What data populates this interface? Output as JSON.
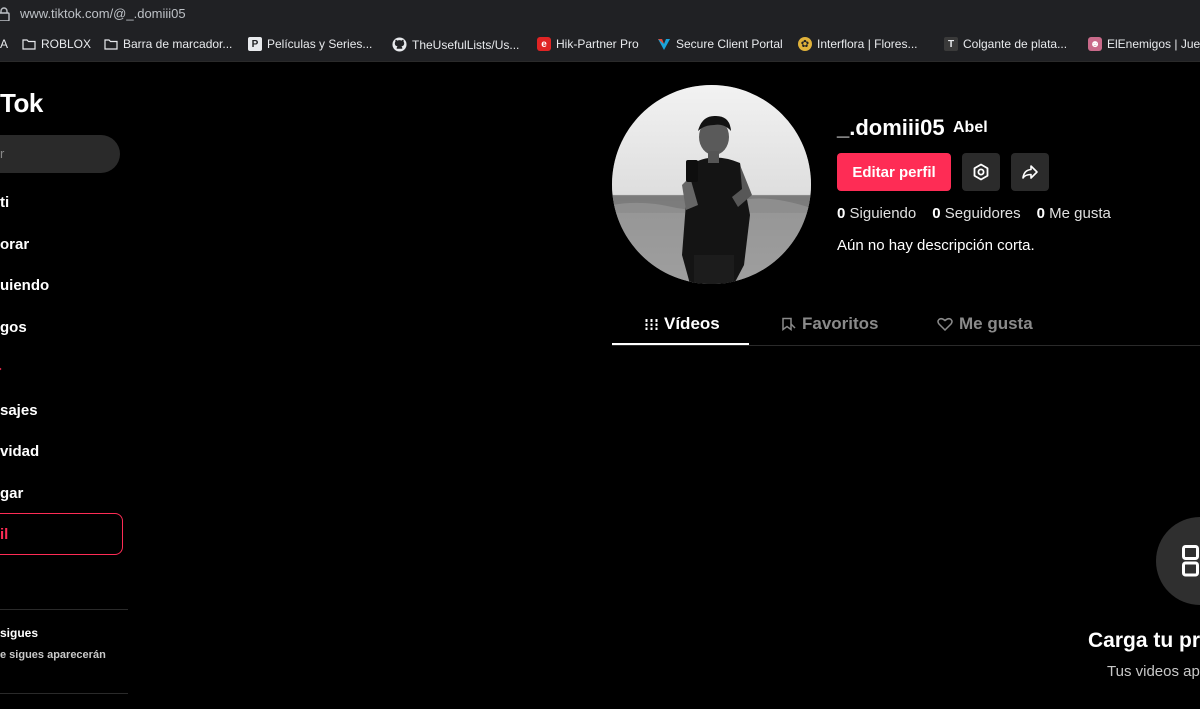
{
  "browser": {
    "url": "www.tiktok.com/@_.domiii05",
    "bookmarks": [
      {
        "label": "A"
      },
      {
        "label": "ROBLOX"
      },
      {
        "label": "Barra de marcador..."
      },
      {
        "label": "Películas y Series..."
      },
      {
        "label": "TheUsefulLists/Us..."
      },
      {
        "label": "Hik-Partner Pro"
      },
      {
        "label": "Secure Client Portal"
      },
      {
        "label": "Interflora | Flores..."
      },
      {
        "label": "Colgante de plata..."
      },
      {
        "label": "ElEnemigos | Jue"
      }
    ]
  },
  "sidebar": {
    "logo": "Tok",
    "search_placeholder": "r",
    "items": [
      {
        "label": "ti"
      },
      {
        "label": "orar"
      },
      {
        "label": "uiendo"
      },
      {
        "label": "gos"
      },
      {
        "label": "sajes"
      },
      {
        "label": "vidad"
      },
      {
        "label": "gar"
      },
      {
        "label": "il"
      }
    ],
    "following_title": "sigues",
    "following_desc": "e sigues aparecerán"
  },
  "profile": {
    "username": "_.domiii05",
    "nickname": "Abel",
    "edit_label": "Editar perfil",
    "following_count": "0",
    "following_label": "Siguiendo",
    "followers_count": "0",
    "followers_label": "Seguidores",
    "likes_count": "0",
    "likes_label": "Me gusta",
    "bio": "Aún no hay descripción corta."
  },
  "tabs": [
    {
      "label": "Vídeos",
      "active": true
    },
    {
      "label": "Favoritos",
      "active": false
    },
    {
      "label": "Me gusta",
      "active": false
    }
  ],
  "empty_state": {
    "title": "Carga tu pr",
    "subtitle": "Tus videos ap"
  },
  "colors": {
    "accent": "#fe2c55",
    "background": "#000000",
    "surface": "#2b2b2b"
  }
}
